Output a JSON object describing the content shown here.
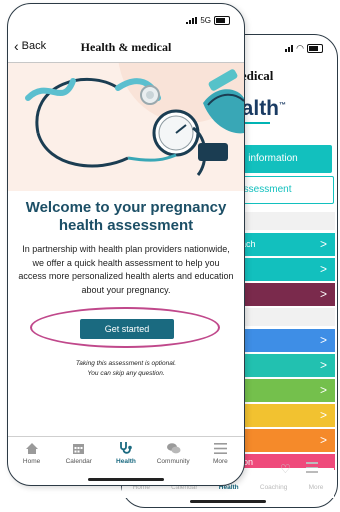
{
  "back_screen": {
    "title": "medical",
    "logo_text": "ealth",
    "logo_mark": "™",
    "care_button": "care information",
    "assessment_button": "th assessment",
    "rows": [
      {
        "label": "h coach",
        "color": "#12c0be"
      },
      {
        "label": "",
        "color": "#12c0be"
      },
      {
        "label": "",
        "color": "#7a2a4c"
      },
      {
        "label": "",
        "color": "#3e8ee6"
      },
      {
        "label": "",
        "color": "#22c1b0"
      },
      {
        "label": "",
        "color": "#74c04c"
      },
      {
        "label": "",
        "color": "#f2c230"
      },
      {
        "label": "",
        "color": "#f58a2a"
      },
      {
        "label": "vention",
        "color": "#ef4a7b"
      }
    ],
    "nav": [
      "Home",
      "Calendar",
      "Health",
      "Coaching",
      "More"
    ],
    "chevron": ">"
  },
  "front_screen": {
    "status": {
      "network": "5G",
      "signal": "signal-icon",
      "battery": "battery-icon"
    },
    "header": {
      "back_label": "Back",
      "title": "Health & medical"
    },
    "hero": {
      "icon": "stethoscope-illustration"
    },
    "heading": "Welcome to your pregnancy health assessment",
    "body": "In partnership with health plan providers nationwide, we offer a quick health assessment to help you access more personalized health alerts and education about your pregnancy.",
    "button": "Get started",
    "note_line1": "Taking this assessment is optional.",
    "note_line2": "You can skip any question.",
    "nav": [
      {
        "label": "Home",
        "icon": "home-icon",
        "active": false
      },
      {
        "label": "Calendar",
        "icon": "calendar-icon",
        "active": false
      },
      {
        "label": "Health",
        "icon": "stethoscope-icon",
        "active": true
      },
      {
        "label": "Community",
        "icon": "chat-bubbles-icon",
        "active": false
      },
      {
        "label": "More",
        "icon": "menu-icon",
        "active": false
      }
    ]
  },
  "colors": {
    "primary": "#1a6a80",
    "heading": "#1c4f66",
    "teal": "#12c0be",
    "highlight": "#c0488b",
    "hero_bg": "#fcefe8"
  }
}
